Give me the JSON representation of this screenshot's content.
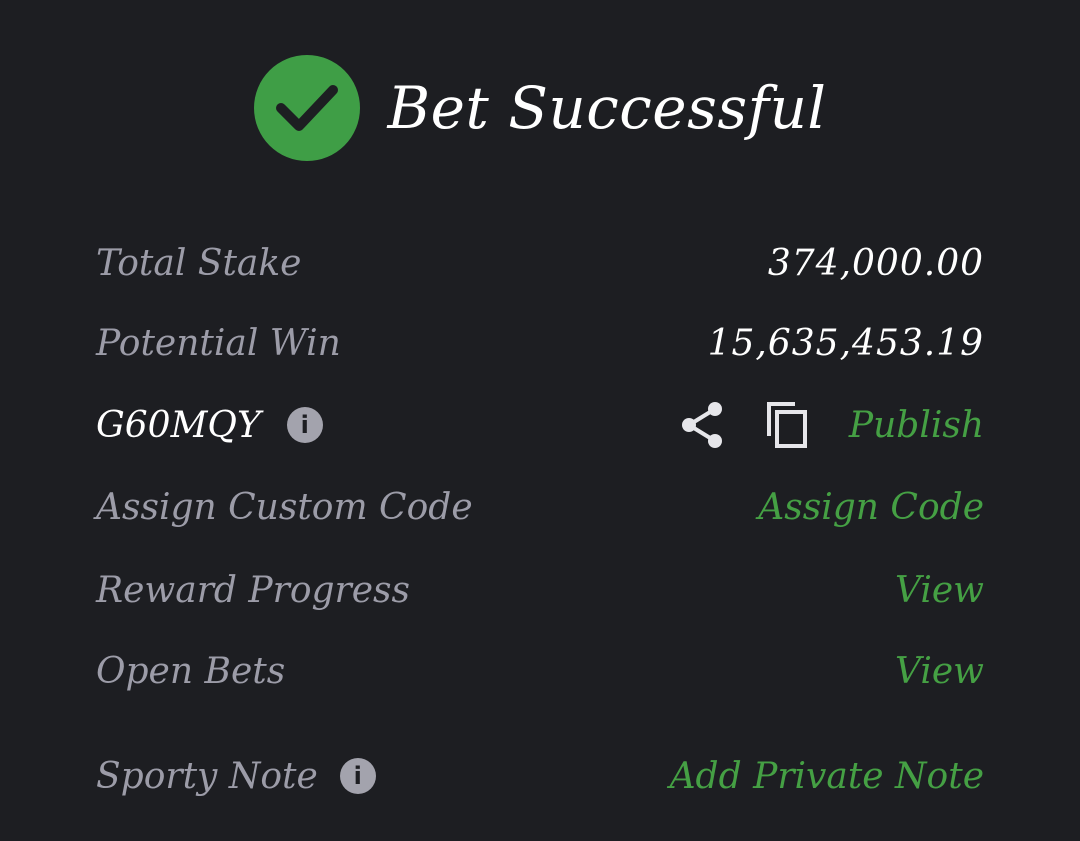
{
  "header": {
    "title": "Bet Successful",
    "icon": "check-circle-icon",
    "accent_color": "#3f9e46"
  },
  "rows": {
    "total_stake": {
      "label": "Total Stake",
      "value": "374,000.00"
    },
    "potential_win": {
      "label": "Potential Win",
      "value": "15,635,453.19"
    },
    "booking": {
      "code": "G60MQY",
      "info_icon": "info-icon",
      "share_icon": "share-icon",
      "copy_icon": "copy-icon",
      "publish_label": "Publish"
    },
    "custom_code": {
      "label": "Assign Custom Code",
      "action": "Assign Code"
    },
    "reward_progress": {
      "label": "Reward Progress",
      "action": "View"
    },
    "open_bets": {
      "label": "Open Bets",
      "action": "View"
    },
    "sporty_note": {
      "label": "Sporty Note",
      "info_icon": "info-icon",
      "action": "Add Private Note"
    }
  },
  "colors": {
    "background": "#1d1e22",
    "label": "#9c9ca8",
    "link": "#45a044",
    "value": "#ffffff"
  }
}
